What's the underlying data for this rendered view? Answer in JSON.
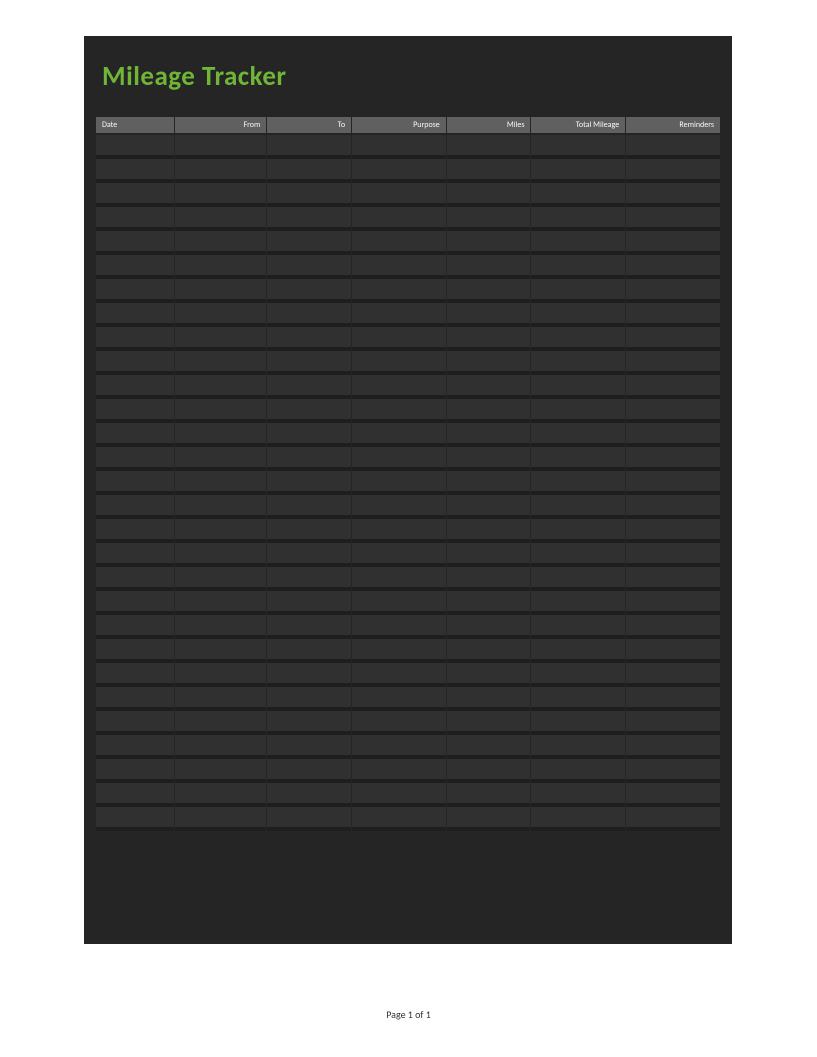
{
  "title": "Mileage Tracker",
  "table": {
    "headers": [
      "Date",
      "From",
      "To",
      "Purpose",
      "Miles",
      "Total Mileage",
      "Reminders"
    ],
    "rowCount": 29
  },
  "footer": {
    "pageIndicator": "Page 1 of 1"
  },
  "colors": {
    "accent": "#6fb536",
    "pageBackground": "#252525",
    "headerBackground": "#606060",
    "cellBackground": "#303030",
    "rowGap": "#1e1e1e"
  }
}
